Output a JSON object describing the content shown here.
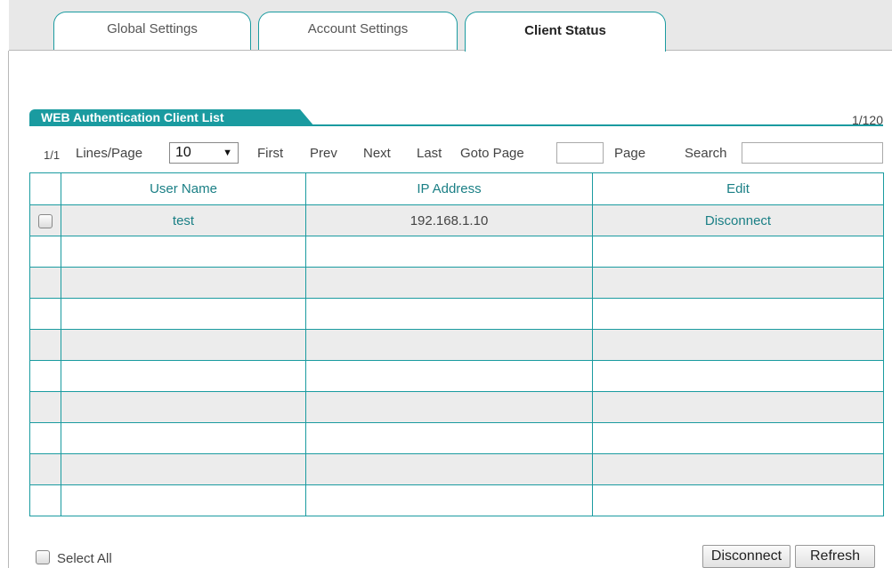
{
  "tabs": [
    {
      "label": "Global Settings",
      "active": false
    },
    {
      "label": "Account Settings",
      "active": false
    },
    {
      "label": "Client Status",
      "active": true
    }
  ],
  "list": {
    "title": "WEB Authentication Client List",
    "count": "1/120"
  },
  "toolbar": {
    "page_count": "1/1",
    "lines_per_page_label": "Lines/Page",
    "lines_per_page_value": "10",
    "first": "First",
    "prev": "Prev",
    "next": "Next",
    "last": "Last",
    "goto_label": "Goto Page",
    "goto_value": "",
    "page_label": "Page",
    "search_label": "Search",
    "search_value": ""
  },
  "table": {
    "columns": [
      "User Name",
      "IP Address",
      "Edit"
    ],
    "rows": [
      {
        "user": "test",
        "ip": "192.168.1.10",
        "action": "Disconnect"
      }
    ],
    "empty_rows": 9
  },
  "footer": {
    "select_all": "Select All",
    "disconnect": "Disconnect",
    "refresh": "Refresh"
  },
  "colors": {
    "accent": "#1a9ba0",
    "row_alt": "#ececec"
  }
}
